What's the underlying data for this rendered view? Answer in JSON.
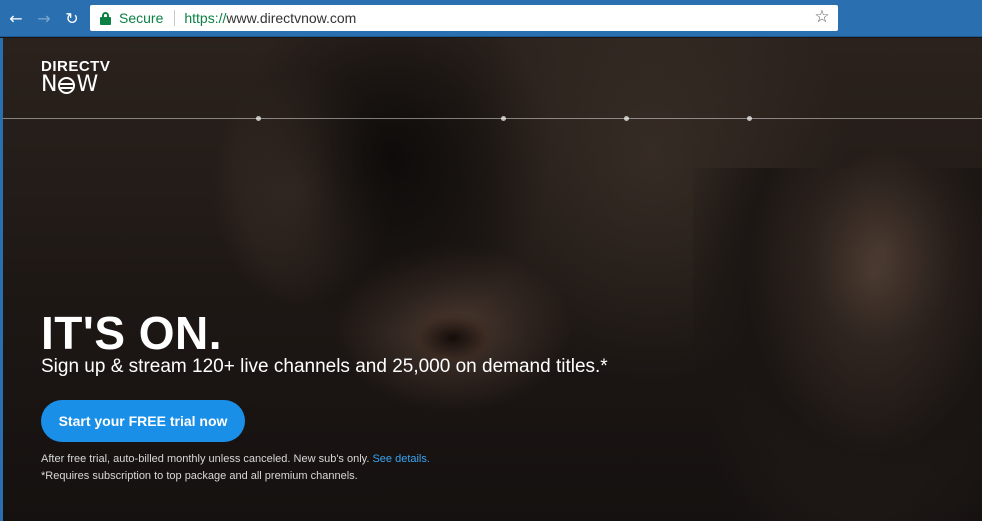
{
  "browser": {
    "back_icon": "←",
    "forward_icon": "→",
    "reload_icon": "↻",
    "secure_label": "Secure",
    "url_protocol": "https://",
    "url_host": "www.directvnow.com",
    "bookmark_icon": "☆"
  },
  "page": {
    "logo_top": "DIRECTV",
    "logo_bottom_left": "N",
    "logo_bottom_right": "W",
    "headline": "IT'S ON.",
    "subline": "Sign up & stream 120+ live channels and 25,000 on demand titles.*",
    "cta_label": "Start your FREE trial now",
    "disclaimer_1": "After free trial, auto-billed monthly unless canceled. New sub's only.",
    "disclaimer_link": "See details.",
    "disclaimer_2": "*Requires subscription to top package and all premium channels."
  },
  "colors": {
    "chrome": "#2a6fb0",
    "secure_green": "#0b8043",
    "cta_blue": "#1a8fe8",
    "link_blue": "#3aa3f0"
  }
}
